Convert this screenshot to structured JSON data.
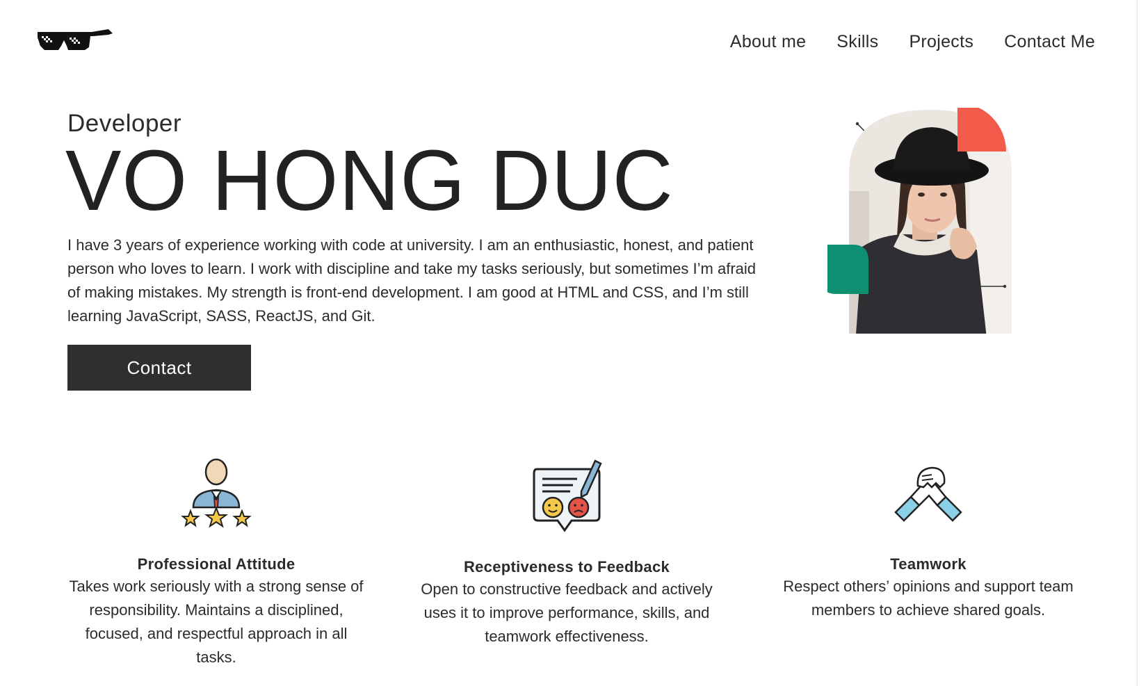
{
  "nav": {
    "items": [
      {
        "label": "About me"
      },
      {
        "label": "Skills"
      },
      {
        "label": "Projects"
      },
      {
        "label": "Contact Me"
      }
    ]
  },
  "hero": {
    "role": "Developer",
    "name": "VO HONG DUC",
    "bio": "I have 3 years of experience working with code at university. I am an enthusiastic, honest, and patient person who loves to learn. I work with discipline and take my tasks seriously, but sometimes I’m afraid of making mistakes. My strength is front-end development. I am good at HTML and CSS, and I’m still learning JavaScript, SASS, ReactJS, and Git.",
    "contact_label": "Contact"
  },
  "features": [
    {
      "icon": "professional-person-icon",
      "title": "Professional Attitude",
      "text": "Takes work seriously with a strong sense of responsibility. Maintains a disciplined, focused, and respectful approach in all tasks."
    },
    {
      "icon": "feedback-icon",
      "title": "Receptiveness to Feedback",
      "text": "Open to constructive feedback and actively uses it to improve performance, skills, and teamwork effectiveness."
    },
    {
      "icon": "handshake-icon",
      "title": "Teamwork",
      "text": "Respect others’ opinions and support team members to achieve shared goals."
    }
  ],
  "colors": {
    "accent_red": "#f25a4a",
    "accent_green": "#0d8f72",
    "button_bg": "#2f2f2f",
    "text": "#2b2b2b"
  }
}
